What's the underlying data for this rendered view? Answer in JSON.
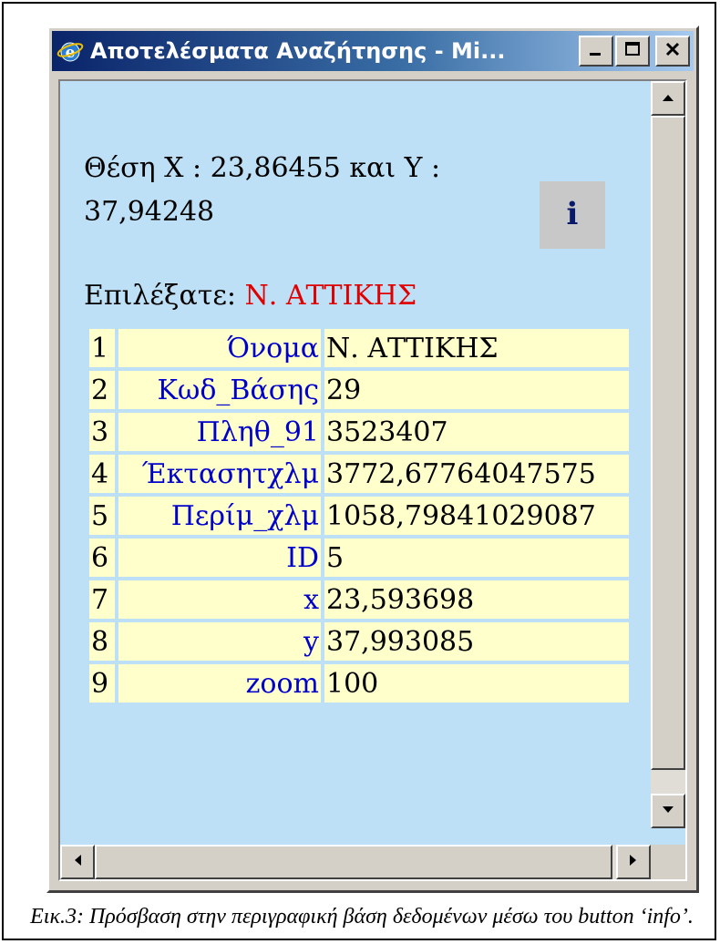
{
  "window": {
    "title": "Αποτελέσματα Αναζήτησης - Mi...",
    "icon": "ie-icon",
    "buttons": [
      "minimize-icon",
      "maximize-icon",
      "close-icon"
    ]
  },
  "position": {
    "line1": "Θέση X : 23,86455 και Y :",
    "line2": "37,94248"
  },
  "info_button": {
    "icon": "info-icon",
    "glyph": "i"
  },
  "selection": {
    "label": "Επιλέξατε:",
    "value": "Ν. ΑΤΤΙΚΗΣ",
    "value_color": "#e00000"
  },
  "attributes": {
    "rows": [
      {
        "index": "1",
        "field": "Όνομα",
        "value": "Ν. ΑΤΤΙΚΗΣ"
      },
      {
        "index": "2",
        "field": "Κωδ_Βάσης",
        "value": "29"
      },
      {
        "index": "3",
        "field": "Πληθ_91",
        "value": "3523407"
      },
      {
        "index": "4",
        "field": "Έκτασητχλμ",
        "value": "3772,67764047575"
      },
      {
        "index": "5",
        "field": "Περίμ_χλμ",
        "value": "1058,79841029087"
      },
      {
        "index": "6",
        "field": "ID",
        "value": "5"
      },
      {
        "index": "7",
        "field": "x",
        "value": "23,593698"
      },
      {
        "index": "8",
        "field": "y",
        "value": "37,993085"
      },
      {
        "index": "9",
        "field": "zoom",
        "value": "100"
      }
    ]
  },
  "caption": "Εικ.3: Πρόσβαση στην περιγραφική βάση δεδομένων μέσω του button ‘info’.",
  "colors": {
    "client_bg": "#bde0f7",
    "cell_bg": "#ffffcc",
    "field_name": "#0000cc",
    "title_bar": "#0a246a"
  }
}
